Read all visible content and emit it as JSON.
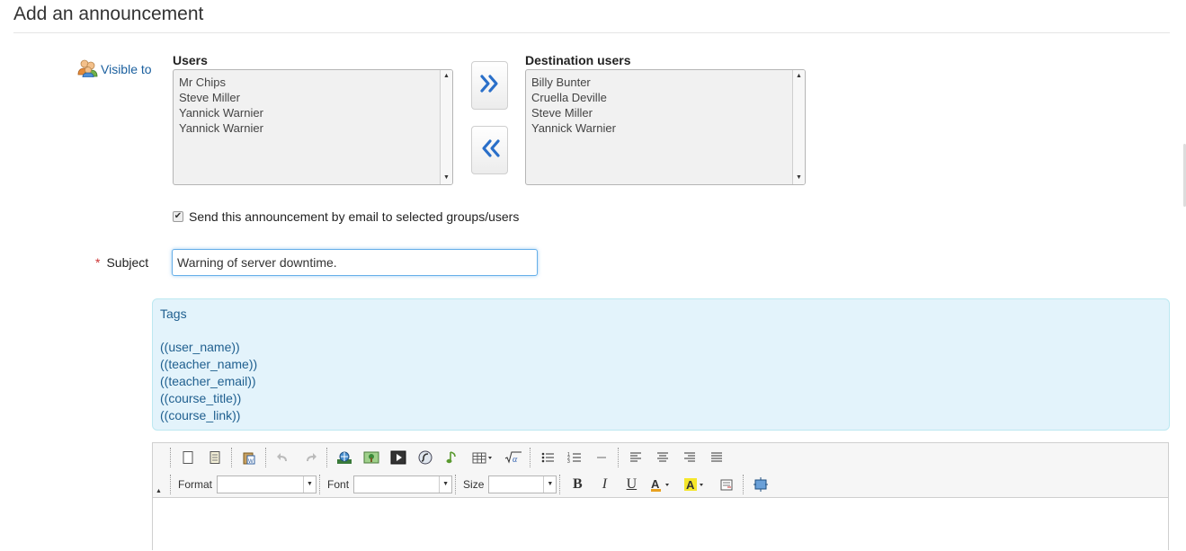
{
  "page": {
    "title": "Add an announcement"
  },
  "visible_to": {
    "label": "Visible to",
    "icon": "users-group-icon"
  },
  "users": {
    "label": "Users",
    "items": [
      "Mr Chips",
      "Steve Miller",
      "Yannick Warnier",
      "Yannick Warnier"
    ]
  },
  "destination": {
    "label": "Destination users",
    "items": [
      "Billy Bunter",
      "Cruella Deville",
      "Steve Miller",
      "Yannick Warnier"
    ]
  },
  "move_buttons": {
    "add_icon": "double-chevron-right-icon",
    "remove_icon": "double-chevron-left-icon"
  },
  "email": {
    "label": "Send this announcement by email to selected groups/users",
    "checked": true
  },
  "subject": {
    "required_mark": "*",
    "label": "Subject",
    "value": "Warning of server downtime."
  },
  "tags": {
    "title": "Tags",
    "items": [
      "((user_name))",
      "((teacher_name))",
      "((teacher_email))",
      "((course_title))",
      "((course_link))"
    ]
  },
  "editor": {
    "format_label": "Format",
    "font_label": "Font",
    "size_label": "Size",
    "format_value": "",
    "font_value": "",
    "size_value": "",
    "bold": "B",
    "italic": "I",
    "underline": "U"
  },
  "colors": {
    "accent": "#1a5f9e",
    "info_bg": "#e3f3fb",
    "required": "#cc3333",
    "arrow_blue": "#2a6fc9"
  }
}
